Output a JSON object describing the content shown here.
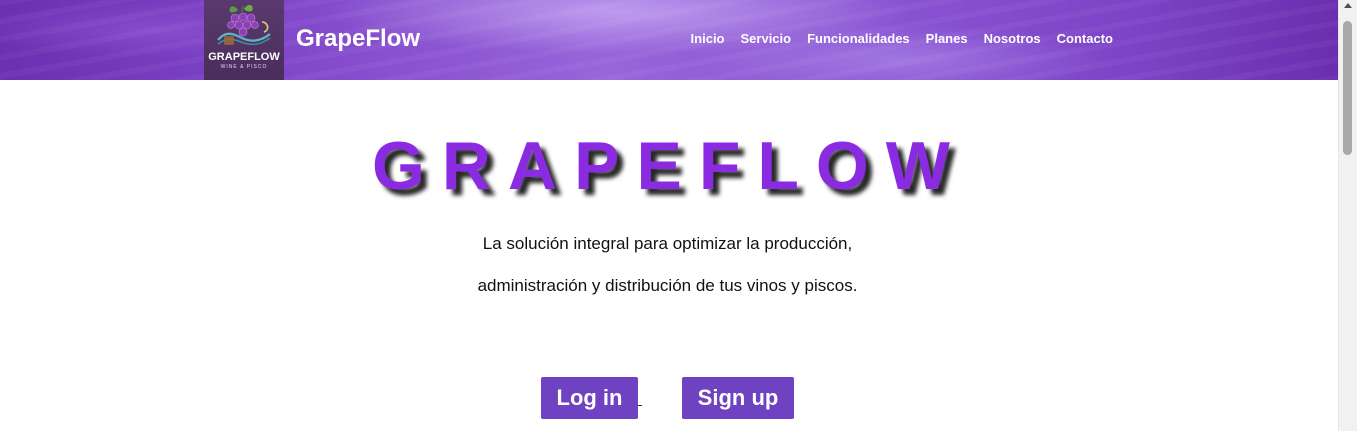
{
  "header": {
    "logo": {
      "text": "GRAPEFLOW",
      "subtext": "WINE & PISCO",
      "icon": "grape-logo-icon"
    },
    "brand": "GrapeFlow",
    "nav": [
      {
        "label": "Inicio"
      },
      {
        "label": "Servicio"
      },
      {
        "label": "Funcionalidades"
      },
      {
        "label": "Planes"
      },
      {
        "label": "Nosotros"
      },
      {
        "label": "Contacto"
      }
    ]
  },
  "hero": {
    "title": "GRAPEFLOW",
    "tagline_line1": "La solución integral para optimizar la producción,",
    "tagline_line2": "administración y distribución de tus vinos y piscos.",
    "login_label": "Log in",
    "signup_label": "Sign up"
  },
  "colors": {
    "accent": "#8a2be2",
    "button": "#6f42c1",
    "header": "#8a55d3"
  }
}
